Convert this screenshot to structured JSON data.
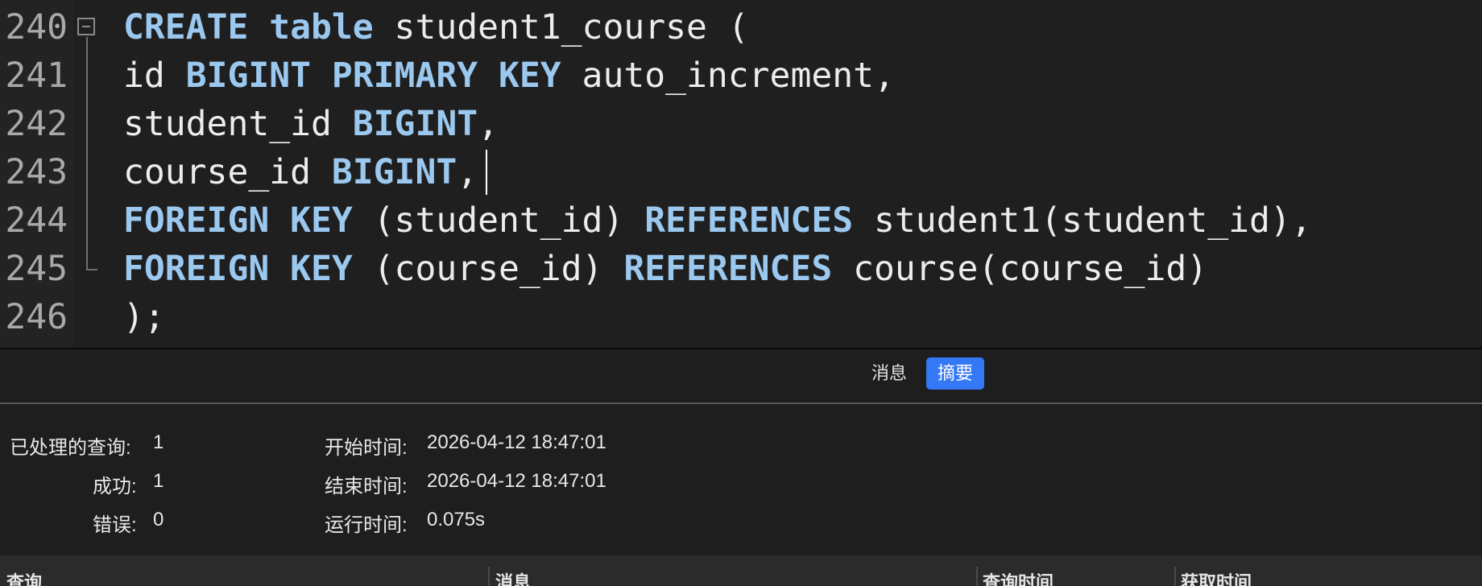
{
  "editor": {
    "lines": [
      {
        "num": "240",
        "tokens": [
          {
            "t": "CREATE table",
            "k": true
          },
          {
            "t": " student1_course (",
            "k": false
          }
        ]
      },
      {
        "num": "241",
        "tokens": [
          {
            "t": "id ",
            "k": false
          },
          {
            "t": "BIGINT PRIMARY KEY",
            "k": true
          },
          {
            "t": " auto_increment,",
            "k": false
          }
        ]
      },
      {
        "num": "242",
        "tokens": [
          {
            "t": "student_id ",
            "k": false
          },
          {
            "t": "BIGINT",
            "k": true
          },
          {
            "t": ",",
            "k": false
          }
        ]
      },
      {
        "num": "243",
        "tokens": [
          {
            "t": "course_id ",
            "k": false
          },
          {
            "t": "BIGINT",
            "k": true
          },
          {
            "t": ",",
            "k": false
          }
        ]
      },
      {
        "num": "244",
        "tokens": [
          {
            "t": "FOREIGN KEY",
            "k": true
          },
          {
            "t": " (student_id) ",
            "k": false
          },
          {
            "t": "REFERENCES",
            "k": true
          },
          {
            "t": " student1(student_id),",
            "k": false
          }
        ]
      },
      {
        "num": "245",
        "tokens": [
          {
            "t": "FOREIGN KEY",
            "k": true
          },
          {
            "t": " (course_id) ",
            "k": false
          },
          {
            "t": "REFERENCES",
            "k": true
          },
          {
            "t": " course(course_id)",
            "k": false
          }
        ]
      },
      {
        "num": "246",
        "tokens": [
          {
            "t": ");",
            "k": false
          }
        ]
      }
    ]
  },
  "tabs": {
    "messages": "消息",
    "summary": "摘要"
  },
  "summary": {
    "processed_label": "已处理的查询:",
    "processed_value": "1",
    "success_label": "成功:",
    "success_value": "1",
    "error_label": "错误:",
    "error_value": "0",
    "start_label": "开始时间:",
    "start_value": "2026-04-12 18:47:01",
    "end_label": "结束时间:",
    "end_value": "2026-04-12 18:47:01",
    "run_label": "运行时间:",
    "run_value": "0.075s"
  },
  "results_header": {
    "col_query": "查询",
    "col_message": "消息",
    "col_query_time": "查询时间",
    "col_fetch_time": "获取时间"
  },
  "colors": {
    "keyword": "#9bc8ef",
    "accent": "#3478f6",
    "background": "#1e1e1e"
  }
}
